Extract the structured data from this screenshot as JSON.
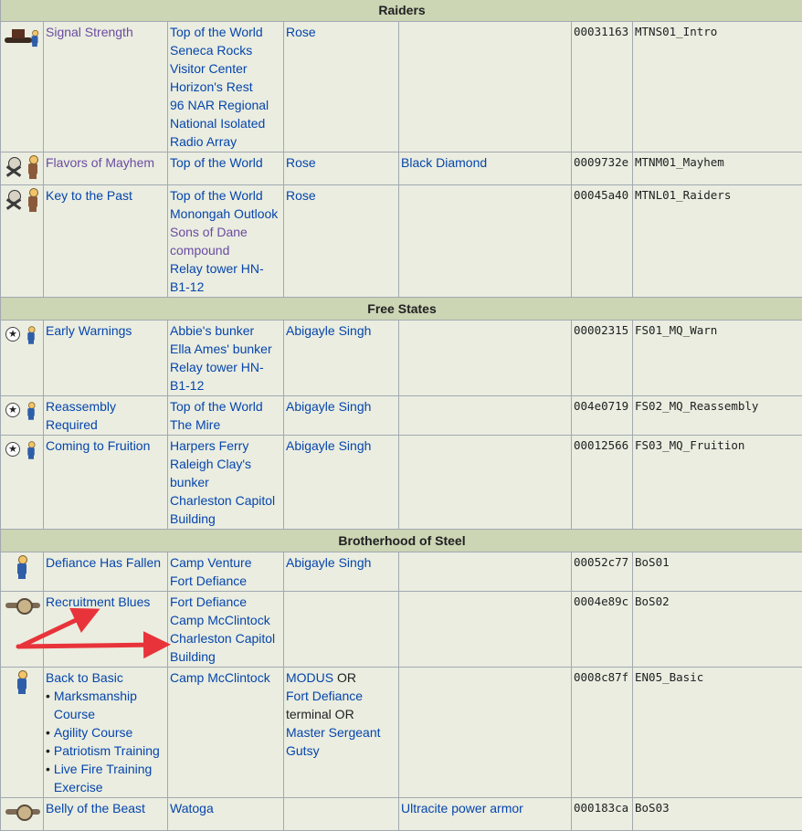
{
  "sections": [
    {
      "title": "Raiders",
      "rows": [
        {
          "icon": "raider-hat-icon",
          "name": "Signal Strength",
          "name_visited": true,
          "locations": [
            "Top of the World",
            "Seneca Rocks Visitor Center",
            "Horizon's Rest",
            "96 NAR Regional National Isolated Radio Array"
          ],
          "giver": "Rose",
          "reward": "",
          "form_id": "00031163",
          "editor_id": "MTNS01_Intro"
        },
        {
          "icon": "raider-skull-icon",
          "name": "Flavors of Mayhem",
          "name_visited": true,
          "locations": [
            "Top of the World"
          ],
          "giver": "Rose",
          "reward": "Black Diamond",
          "form_id": "0009732e",
          "editor_id": "MTNM01_Mayhem"
        },
        {
          "icon": "raider-skull-icon",
          "name": "Key to the Past",
          "name_visited": false,
          "locations": [
            "Top of the World",
            "Monongah Outlook",
            "Sons of Dane compound",
            "Relay tower HN-B1-12"
          ],
          "giver": "Rose",
          "reward": "",
          "form_id": "00045a40",
          "editor_id": "MTNL01_Raiders"
        }
      ]
    },
    {
      "title": "Free States",
      "rows": [
        {
          "icon": "free-states-star-icon",
          "name": "Early Warnings",
          "name_visited": false,
          "locations": [
            "Abbie's bunker",
            "Ella Ames' bunker",
            "Relay tower HN-B1-12"
          ],
          "giver": "Abigayle Singh",
          "reward": "",
          "form_id": "00002315",
          "editor_id": "FS01_MQ_Warn"
        },
        {
          "icon": "free-states-star-icon",
          "name": "Reassembly Required",
          "name_visited": false,
          "locations": [
            "Top of the World",
            "The Mire"
          ],
          "giver": "Abigayle Singh",
          "reward": "",
          "form_id": "004e0719",
          "editor_id": "FS02_MQ_Reassembly"
        },
        {
          "icon": "free-states-star-icon",
          "name": "Coming to Fruition",
          "name_visited": false,
          "locations": [
            "Harpers Ferry",
            "Raleigh Clay's bunker",
            "Charleston Capitol Building"
          ],
          "giver": "Abigayle Singh",
          "reward": "",
          "form_id": "00012566",
          "editor_id": "FS03_MQ_Fruition"
        }
      ]
    },
    {
      "title": "Brotherhood of Steel",
      "rows": [
        {
          "icon": "vault-boy-icon",
          "name": "Defiance Has Fallen",
          "name_visited": false,
          "locations": [
            "Camp Venture",
            "Fort Defiance"
          ],
          "giver": "Abigayle Singh",
          "reward": "",
          "form_id": "00052c77",
          "editor_id": "BoS01"
        },
        {
          "icon": "bos-emblem-icon",
          "name": "Recruitment Blues",
          "name_visited": false,
          "locations": [
            "Fort Defiance",
            "Camp McClintock",
            "Charleston Capitol Building"
          ],
          "giver": "",
          "reward": "",
          "form_id": "0004e89c",
          "editor_id": "BoS02"
        },
        {
          "icon": "vault-boy-icon",
          "name": "Back to Basic",
          "name_visited": false,
          "subquests": [
            "Marksmanship Course",
            "Agility Course",
            "Patriotism Training",
            "Live Fire Training Exercise"
          ],
          "locations": [
            "Camp McClintock"
          ],
          "giver_parts": [
            {
              "text": "MODUS",
              "link": true
            },
            {
              "text": " OR ",
              "link": false
            },
            {
              "text": "Fort Defiance",
              "link": true
            },
            {
              "text": "terminal OR",
              "link": false
            },
            {
              "text": "Master Sergeant Gutsy",
              "link": true
            }
          ],
          "giver": "",
          "reward": "",
          "form_id": "0008c87f",
          "editor_id": "EN05_Basic"
        },
        {
          "icon": "bos-emblem-icon",
          "name": "Belly of the Beast",
          "name_visited": false,
          "locations": [
            "Watoga"
          ],
          "giver": "",
          "reward": "Ultracite power armor",
          "form_id": "000183ca",
          "editor_id": "BoS03"
        }
      ]
    }
  ],
  "annotation_color": "#e8333a"
}
